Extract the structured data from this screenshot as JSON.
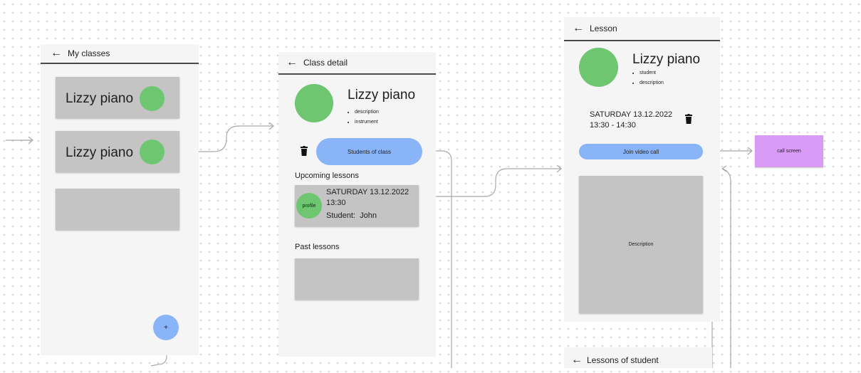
{
  "screen1": {
    "title": "My classes",
    "cards": [
      {
        "label": "Lizzy piano"
      },
      {
        "label": "Lizzy piano"
      }
    ],
    "fab_label": "+"
  },
  "screen2": {
    "title": "Class detail",
    "class_name": "Lizzy piano",
    "bullets": [
      "description",
      "instrument"
    ],
    "students_button": "Students of class",
    "upcoming_heading": "Upcoming lessons",
    "upcoming": {
      "avatar_label": "profile",
      "datetime": "SATURDAY 13.12.2022\n13:30",
      "student": "Student:  John"
    },
    "past_heading": "Past lessons"
  },
  "screen3": {
    "title": "Lesson",
    "class_name": "Lizzy piano",
    "bullets": [
      "student",
      "description"
    ],
    "date": "SATURDAY 13.12.2022",
    "time": "13:30 - 14:30",
    "join_button": "Join video call",
    "description_label": "Description"
  },
  "call_screen": {
    "label": "call screen"
  },
  "screen4": {
    "title": "Lessons of student"
  },
  "colors": {
    "accent_blue": "#8ab4f8",
    "avatar_green": "#6ec670",
    "card_gray": "#c4c4c4",
    "call_purple": "#d89cf6"
  },
  "icons": [
    "arrow-left-icon",
    "trash-icon"
  ]
}
